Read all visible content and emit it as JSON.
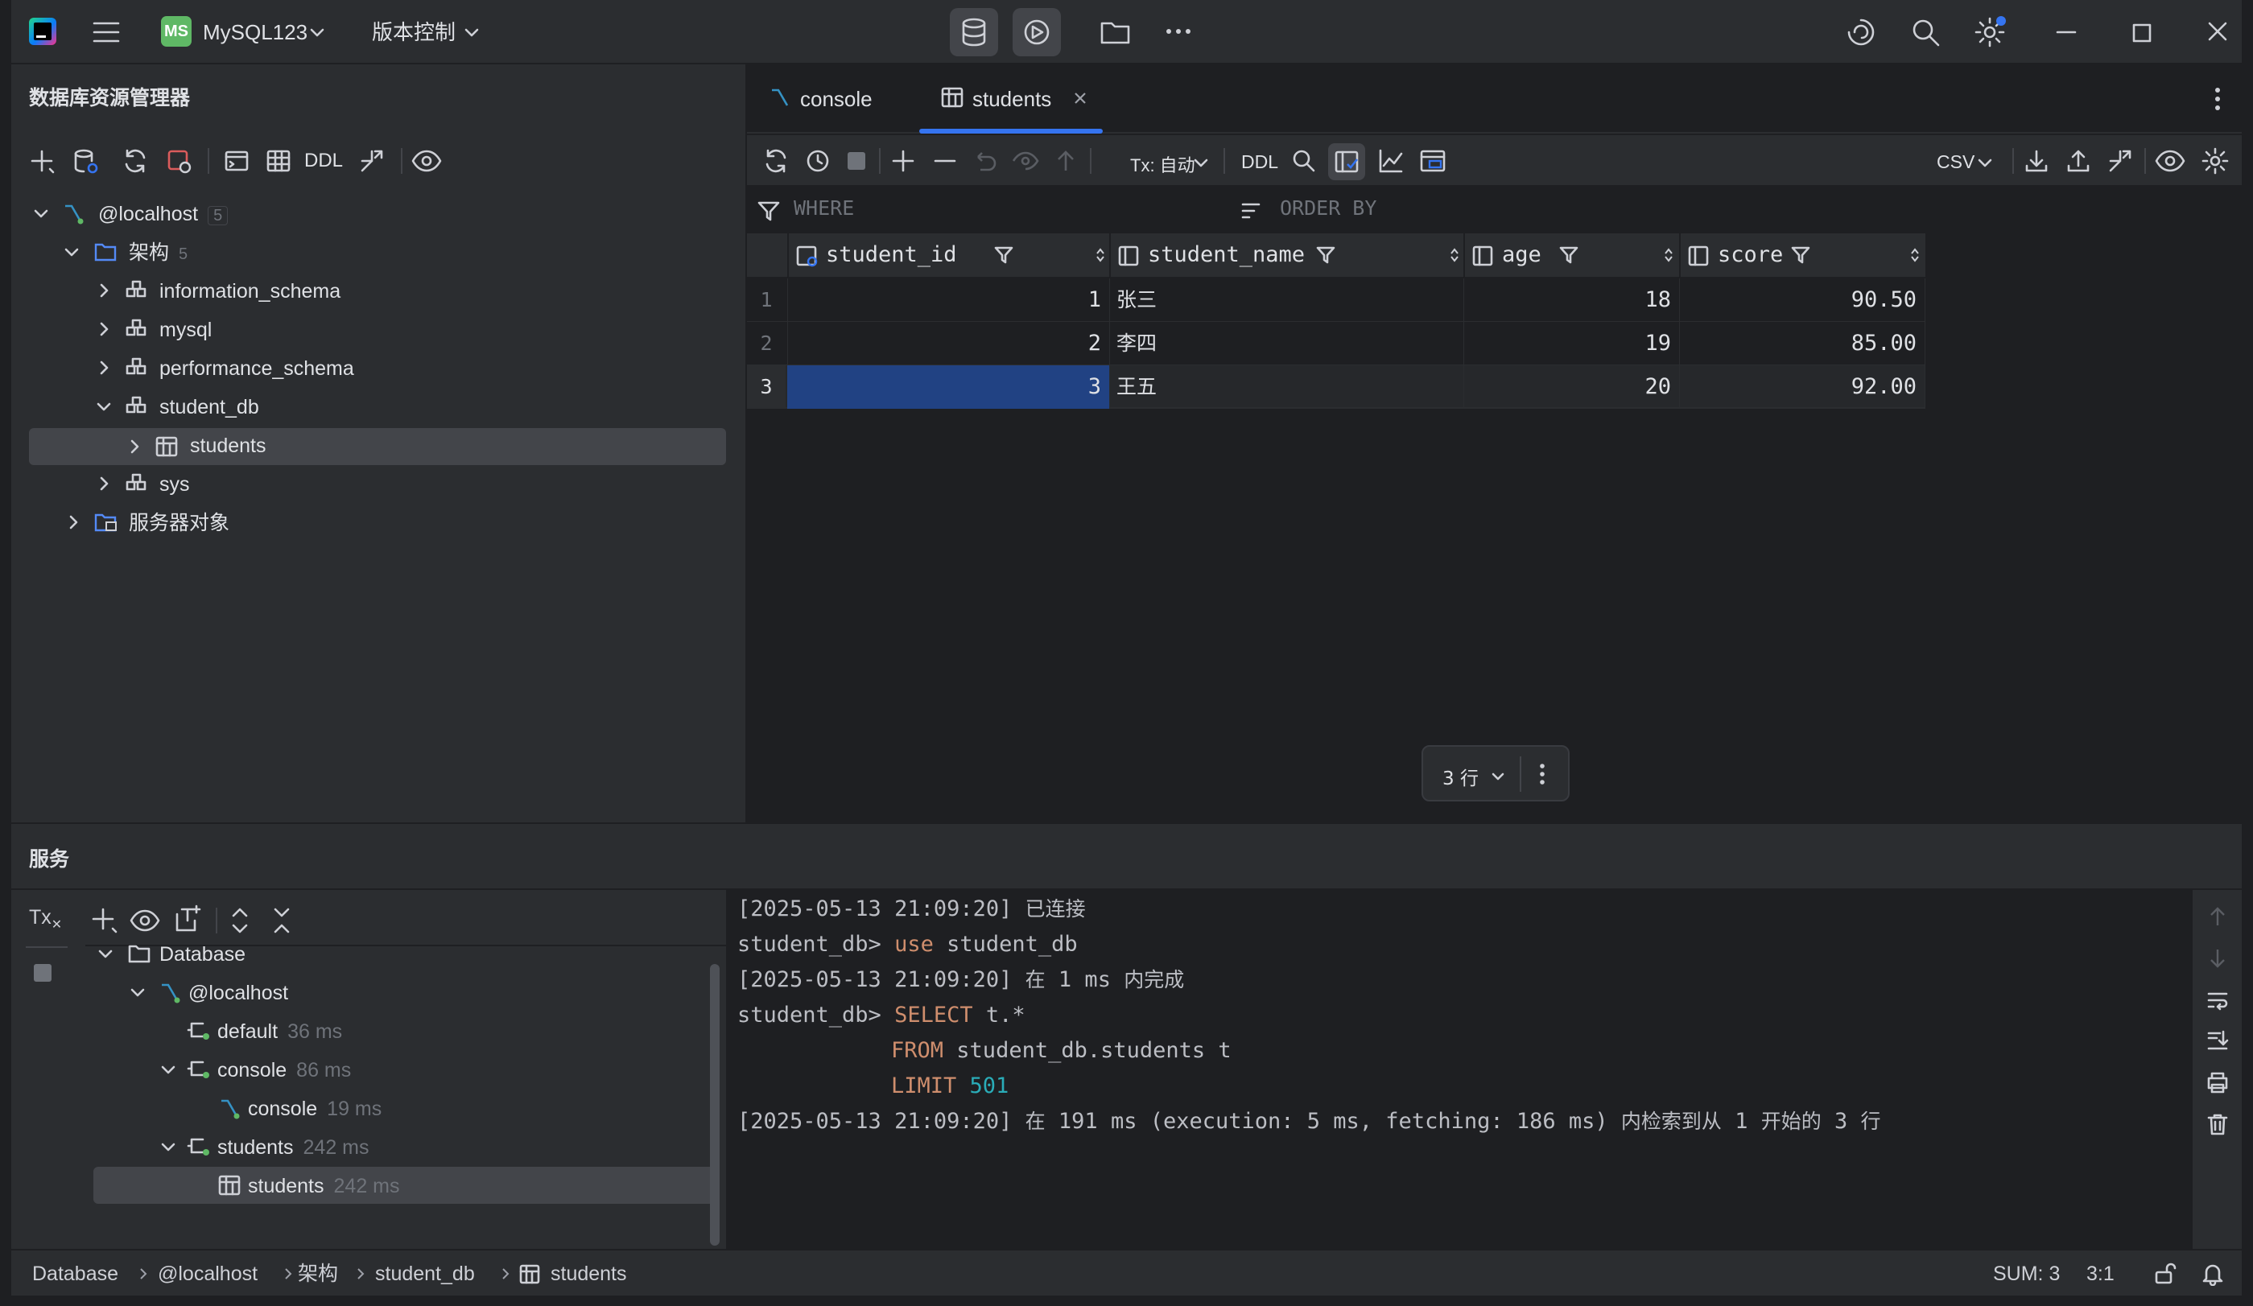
{
  "titlebar": {
    "project_badge": "MS",
    "project_name": "MySQL123",
    "vcs_label": "版本控制"
  },
  "explorer": {
    "title": "数据库资源管理器",
    "toolbar_ddl": "DDL",
    "root_label": "@localhost",
    "root_count": "5",
    "schemas_label": "架构",
    "schemas_count": "5",
    "items": [
      "information_schema",
      "mysql",
      "performance_schema",
      "student_db",
      "students",
      "sys"
    ],
    "server_objects": "服务器对象"
  },
  "editor": {
    "tabs": [
      {
        "label": "console"
      },
      {
        "label": "students"
      }
    ],
    "toolbar": {
      "tx_label": "Tx: 自动",
      "ddl": "DDL",
      "export_format": "CSV"
    },
    "where_label": "WHERE",
    "orderby_label": "ORDER BY",
    "columns": [
      "student_id",
      "student_name",
      "age",
      "score"
    ],
    "rows": [
      {
        "no": "1",
        "student_id": "1",
        "student_name": "张三",
        "age": "18",
        "score": "90.50"
      },
      {
        "no": "2",
        "student_id": "2",
        "student_name": "李四",
        "age": "19",
        "score": "85.00"
      },
      {
        "no": "3",
        "student_id": "3",
        "student_name": "王五",
        "age": "20",
        "score": "92.00"
      }
    ],
    "row_count_label": "3 行"
  },
  "services": {
    "title": "服务",
    "tx_label": "Tx",
    "tree": {
      "database": "Database",
      "localhost": "@localhost",
      "default": "default",
      "default_time": "36 ms",
      "console_group": "console",
      "console_group_time": "86 ms",
      "console": "console",
      "console_time": "19 ms",
      "students_group": "students",
      "students_group_time": "242 ms",
      "students": "students",
      "students_time": "242 ms"
    },
    "log": {
      "ts1": "[2025-05-13 21:09:20]",
      "connected": "已连接",
      "prompt": "student_db>",
      "use_kw": "use",
      "use_target": "student_db",
      "ts2": "[2025-05-13 21:09:20]",
      "done_pre": "在",
      "done_ms": "1 ms",
      "done_post": "内完成",
      "select_kw": "SELECT",
      "select_expr": "t.*",
      "from_kw": "FROM",
      "from_expr": "student_db.students t",
      "limit_kw": "LIMIT",
      "limit_val": "501",
      "ts3": "[2025-05-13 21:09:20]",
      "res_pre": "在",
      "res_ms": "191 ms (execution: 5 ms, fetching: 186 ms)",
      "res_mid": "内检索到从",
      "res_from": "1",
      "res_start": "开始的",
      "res_count": "3",
      "res_rows": "行"
    }
  },
  "statusbar": {
    "crumbs": [
      "Database",
      "@localhost",
      "架构",
      "student_db",
      "students"
    ],
    "sum": "SUM: 3",
    "position": "3:1"
  }
}
